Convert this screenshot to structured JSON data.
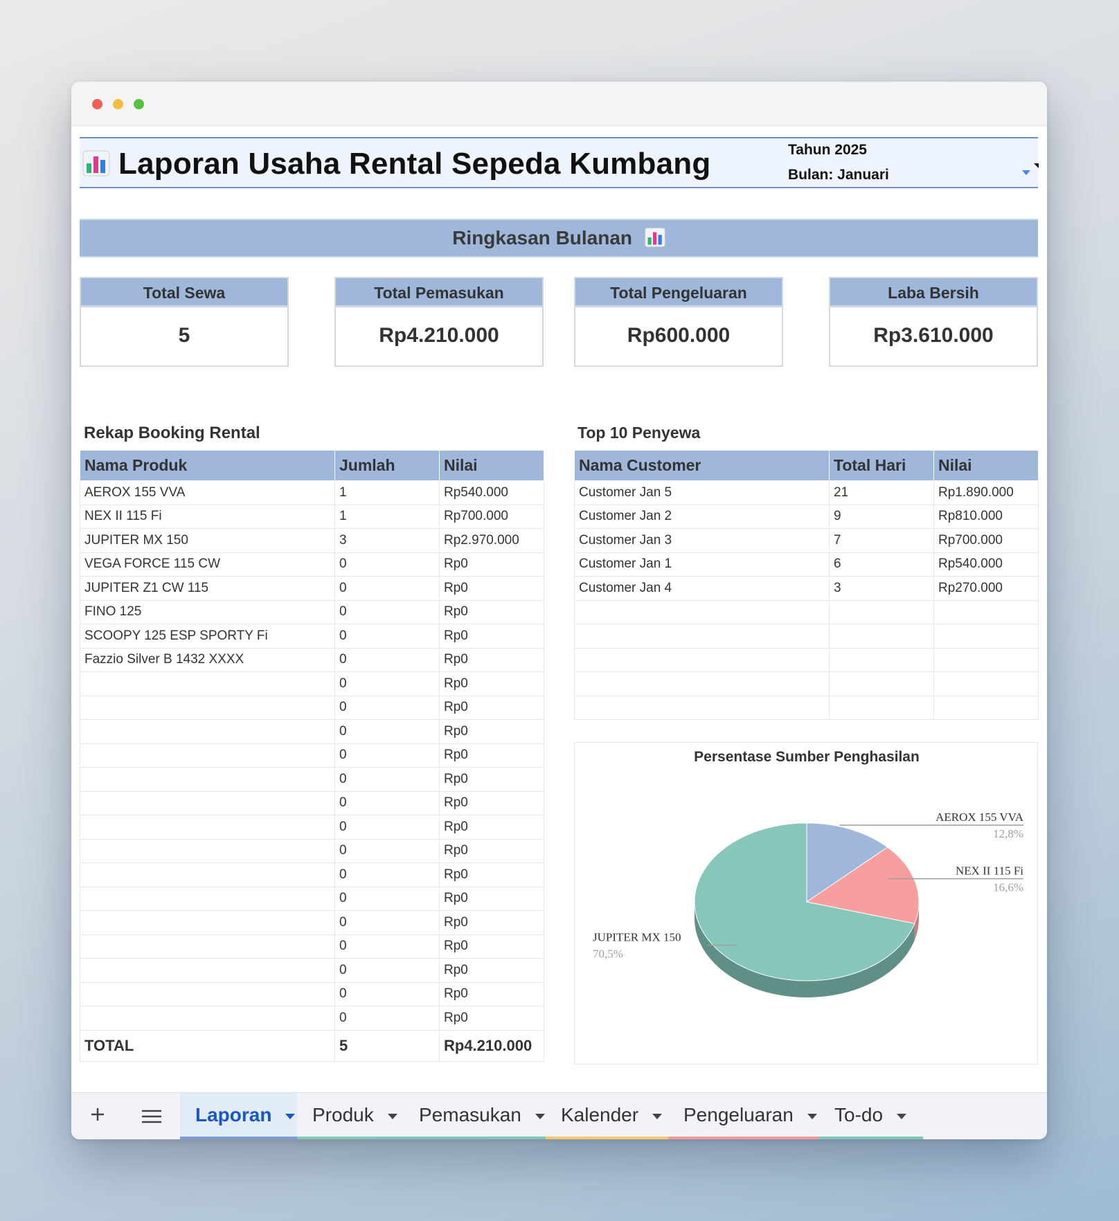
{
  "header": {
    "title": "Laporan Usaha Rental Sepeda Kumbang",
    "year": "Tahun 2025",
    "month": "Bulan: Januari"
  },
  "summary": {
    "title": "Ringkasan Bulanan",
    "cards": [
      {
        "label": "Total Sewa",
        "value": "5"
      },
      {
        "label": "Total Pemasukan",
        "value": "Rp4.210.000"
      },
      {
        "label": "Total Pengeluaran",
        "value": "Rp600.000"
      },
      {
        "label": "Laba Bersih",
        "value": "Rp3.610.000"
      }
    ]
  },
  "booking": {
    "title": "Rekap Booking Rental",
    "headers": [
      "Nama Produk",
      "Jumlah",
      "Nilai"
    ],
    "rows": [
      [
        "AEROX 155 VVA",
        "1",
        "Rp540.000"
      ],
      [
        "NEX II 115 Fi",
        "1",
        "Rp700.000"
      ],
      [
        "JUPITER MX 150",
        "3",
        "Rp2.970.000"
      ],
      [
        "VEGA FORCE 115 CW",
        "0",
        "Rp0"
      ],
      [
        "JUPITER Z1 CW 115",
        "0",
        "Rp0"
      ],
      [
        "FINO 125",
        "0",
        "Rp0"
      ],
      [
        "SCOOPY 125 ESP SPORTY Fi",
        "0",
        "Rp0"
      ],
      [
        "Fazzio Silver B 1432 XXXX",
        "0",
        "Rp0"
      ],
      [
        "",
        "0",
        "Rp0"
      ],
      [
        "",
        "0",
        "Rp0"
      ],
      [
        "",
        "0",
        "Rp0"
      ],
      [
        "",
        "0",
        "Rp0"
      ],
      [
        "",
        "0",
        "Rp0"
      ],
      [
        "",
        "0",
        "Rp0"
      ],
      [
        "",
        "0",
        "Rp0"
      ],
      [
        "",
        "0",
        "Rp0"
      ],
      [
        "",
        "0",
        "Rp0"
      ],
      [
        "",
        "0",
        "Rp0"
      ],
      [
        "",
        "0",
        "Rp0"
      ],
      [
        "",
        "0",
        "Rp0"
      ],
      [
        "",
        "0",
        "Rp0"
      ],
      [
        "",
        "0",
        "Rp0"
      ],
      [
        "",
        "0",
        "Rp0"
      ]
    ],
    "total": [
      "TOTAL",
      "5",
      "Rp4.210.000"
    ]
  },
  "top10": {
    "title": "Top 10 Penyewa",
    "headers": [
      "Nama Customer",
      "Total Hari",
      "Nilai"
    ],
    "rows": [
      [
        "Customer Jan 5",
        "21",
        "Rp1.890.000"
      ],
      [
        "Customer Jan 2",
        "9",
        "Rp810.000"
      ],
      [
        "Customer Jan 3",
        "7",
        "Rp700.000"
      ],
      [
        "Customer Jan 1",
        "6",
        "Rp540.000"
      ],
      [
        "Customer Jan 4",
        "3",
        "Rp270.000"
      ],
      [
        "",
        "",
        ""
      ],
      [
        "",
        "",
        ""
      ],
      [
        "",
        "",
        ""
      ],
      [
        "",
        "",
        ""
      ],
      [
        "",
        "",
        ""
      ]
    ]
  },
  "chart_data": {
    "type": "pie",
    "title": "Persentase Sumber Penghasilan",
    "slices": [
      {
        "label": "AEROX 155 VVA",
        "value": 12.8,
        "display": "12,8%",
        "color": "#9fb7da",
        "side_color": "#7f94b3"
      },
      {
        "label": "NEX II 115 Fi",
        "value": 16.6,
        "display": "16,6%",
        "color": "#f79e9e",
        "side_color": "#c77f7f"
      },
      {
        "label": "JUPITER MX 150",
        "value": 70.5,
        "display": "70,5%",
        "color": "#87c6ba",
        "side_color": "#5f8f86"
      }
    ]
  },
  "tabs": {
    "add_icon": "plus-icon",
    "menu_icon": "menu-icon",
    "items": [
      {
        "label": "Laporan",
        "color": "#7f9bd0",
        "active": true
      },
      {
        "label": "Produk",
        "color": "#7fc8b8",
        "active": false
      },
      {
        "label": "Pemasukan",
        "color": "#7fc8b8",
        "active": false
      },
      {
        "label": "Kalender",
        "color": "#f5c874",
        "active": false
      },
      {
        "label": "Pengeluaran",
        "color": "#f29a9a",
        "active": false
      },
      {
        "label": "To-do",
        "color": "#7fc8b8",
        "active": false
      }
    ]
  }
}
